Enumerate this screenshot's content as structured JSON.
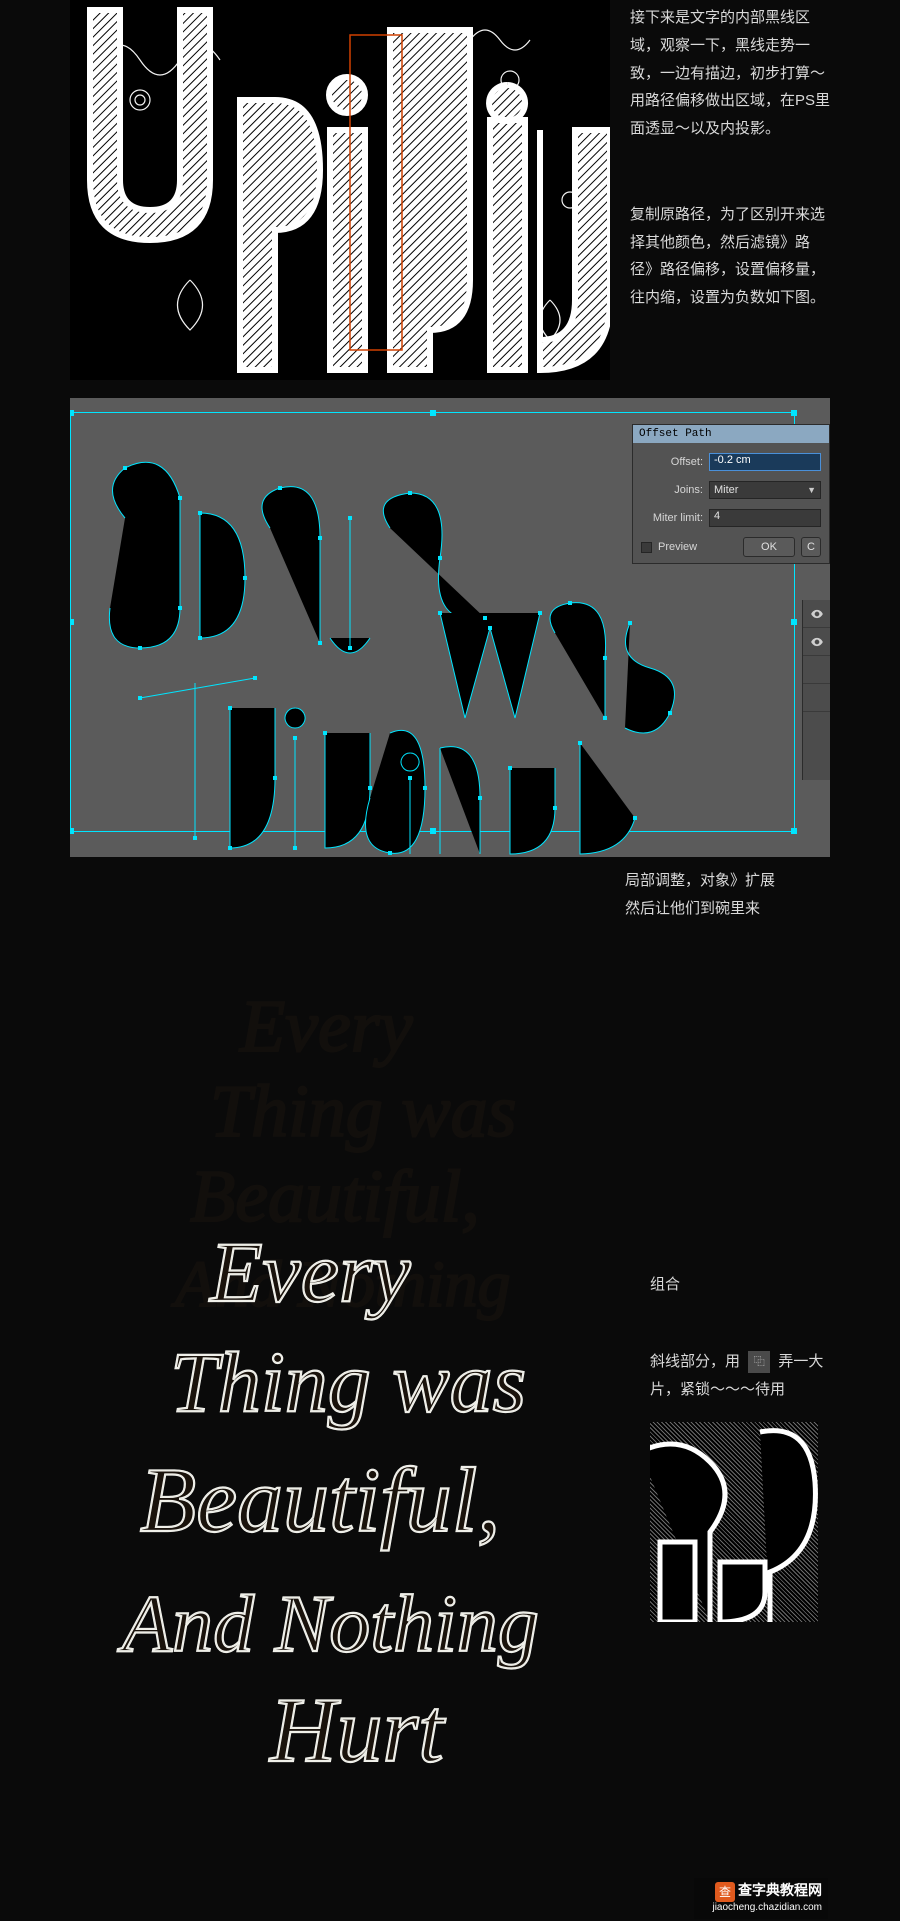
{
  "section1": {
    "paragraph_a": "接下来是文字的内部黑线区域，观察一下，黑线走势一致，一边有描边，初步打算～用路径偏移做出区域，在PS里面透显～以及内投影。",
    "paragraph_b": "复制原路径，为了区别开来选择其他颜色，然后滤镜》路径》路径偏移，设置偏移量，往内缩，设置为负数如下图。"
  },
  "dialog": {
    "title": "Offset Path",
    "offset_label": "Offset:",
    "offset_value": "-0.2 cm",
    "joins_label": "Joins:",
    "joins_value": "Miter",
    "miter_label": "Miter limit:",
    "miter_value": "4",
    "preview_label": "Preview",
    "ok_label": "OK",
    "cancel_label": "C"
  },
  "caption2": {
    "line_a": "局部调整，对象》扩展",
    "line_b": "然后让他们到碗里来"
  },
  "final": {
    "combo_label": "组合",
    "diag_prefix": "斜线部分，用",
    "diag_suffix": "弄一大片，紧锁～～～待用",
    "icon_glyph": "⿻"
  },
  "typography_phrase": {
    "line1": "Every",
    "line2": "Thing was",
    "line3": "Beautiful,",
    "line4": "And Nothing",
    "line5": "Hurt"
  },
  "watermark": {
    "brand": "查字典教程网",
    "url": "jiaocheng.chazidian.com",
    "logo": "查"
  },
  "colors": {
    "page_bg": "#0a0a0a",
    "ai_canvas": "#5b5b5b",
    "selection": "#00e5ff",
    "dialog_title": "#8ba8c1",
    "text": "#d9d9d9"
  }
}
